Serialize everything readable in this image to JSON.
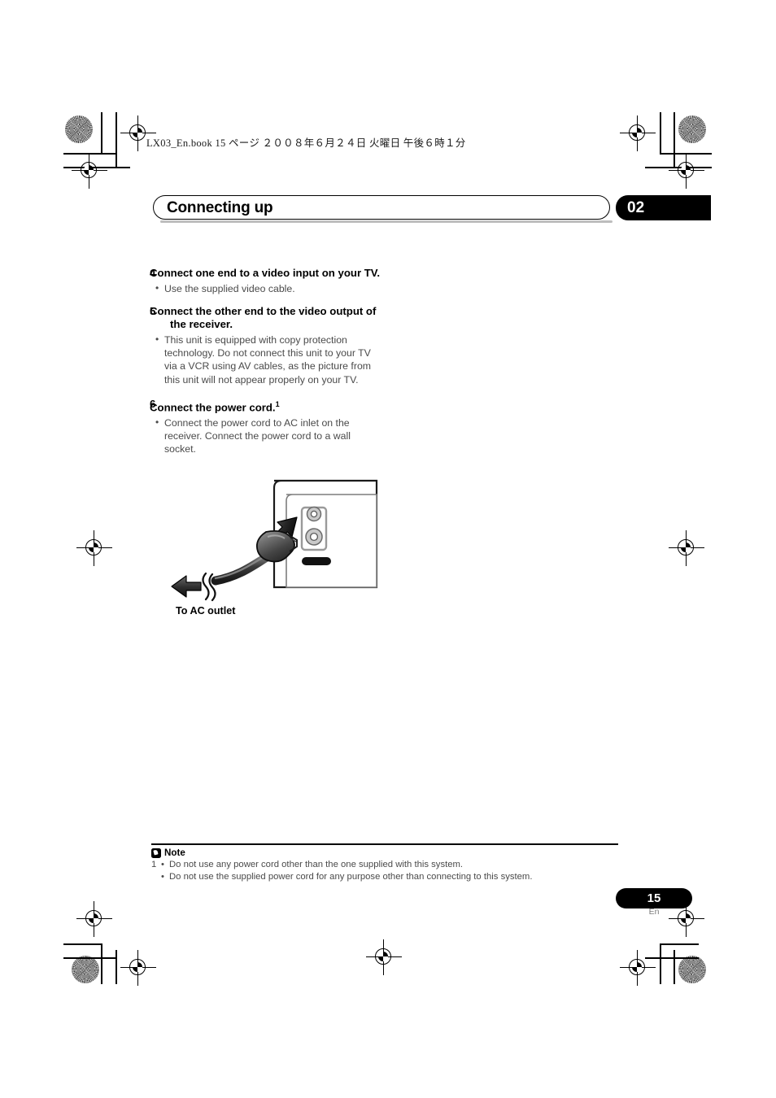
{
  "print_header": {
    "book_line": "LX03_En.book  15 ページ  ２００８年６月２４日  火曜日  午後６時１分"
  },
  "chapter": {
    "title": "Connecting up",
    "number": "02"
  },
  "steps": [
    {
      "number": "4",
      "title": "Connect one end to a video input on your TV.",
      "bullets": [
        "Use the supplied video cable."
      ]
    },
    {
      "number": "5",
      "title": "Connect the other end to the video output of the receiver.",
      "bullets": [
        "This unit is equipped with copy protection technology. Do not connect this unit to your TV via a VCR using AV cables, as the picture from this unit will not appear properly on your TV."
      ]
    },
    {
      "number": "6",
      "title": "Connect the power cord.",
      "footnote_marker": "1",
      "bullets": [
        "Connect the power cord to AC inlet on the receiver. Connect the power cord to a wall socket."
      ]
    }
  ],
  "figure": {
    "caption": "To AC outlet",
    "description": "Power cord plug being inserted into the AC inlet on the rear panel of the receiver"
  },
  "note": {
    "title": "Note",
    "items": [
      {
        "marker": "1",
        "text": "Do not use any power cord other than the one supplied with this system."
      },
      {
        "marker": "",
        "text": "Do not use the supplied power cord for any purpose other than connecting to this system."
      }
    ]
  },
  "footer": {
    "page_number": "15",
    "language": "En"
  }
}
